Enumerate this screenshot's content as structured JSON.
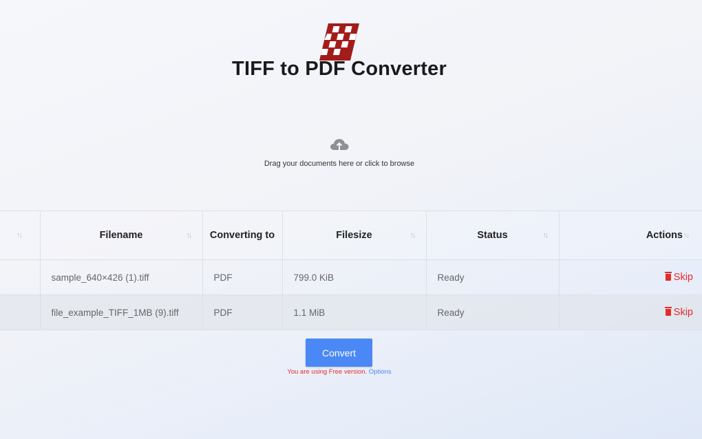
{
  "app": {
    "title": "TIFF to PDF Converter",
    "logo_icon": "checkered-red-document-icon",
    "brand_color": "#a31c1c"
  },
  "dropzone": {
    "icon": "cloud-upload-icon",
    "text": "Drag your documents here or click to browse"
  },
  "table": {
    "columns": [
      "",
      "Filename",
      "Converting to",
      "Filesize",
      "Status",
      "Actions"
    ],
    "rows": [
      {
        "filename": "sample_640×426 (1).tiff",
        "target": "PDF",
        "size": "799.0 KiB",
        "status": "Ready",
        "action": "Skip"
      },
      {
        "filename": "file_example_TIFF_1MB (9).tiff",
        "target": "PDF",
        "size": "1.1 MiB",
        "status": "Ready",
        "action": "Skip"
      }
    ]
  },
  "convert": {
    "label": "Convert",
    "color": "#4a88f6"
  },
  "version": {
    "text": "You are using Free version.",
    "link": "Options",
    "warning_color": "#e52b2b"
  }
}
